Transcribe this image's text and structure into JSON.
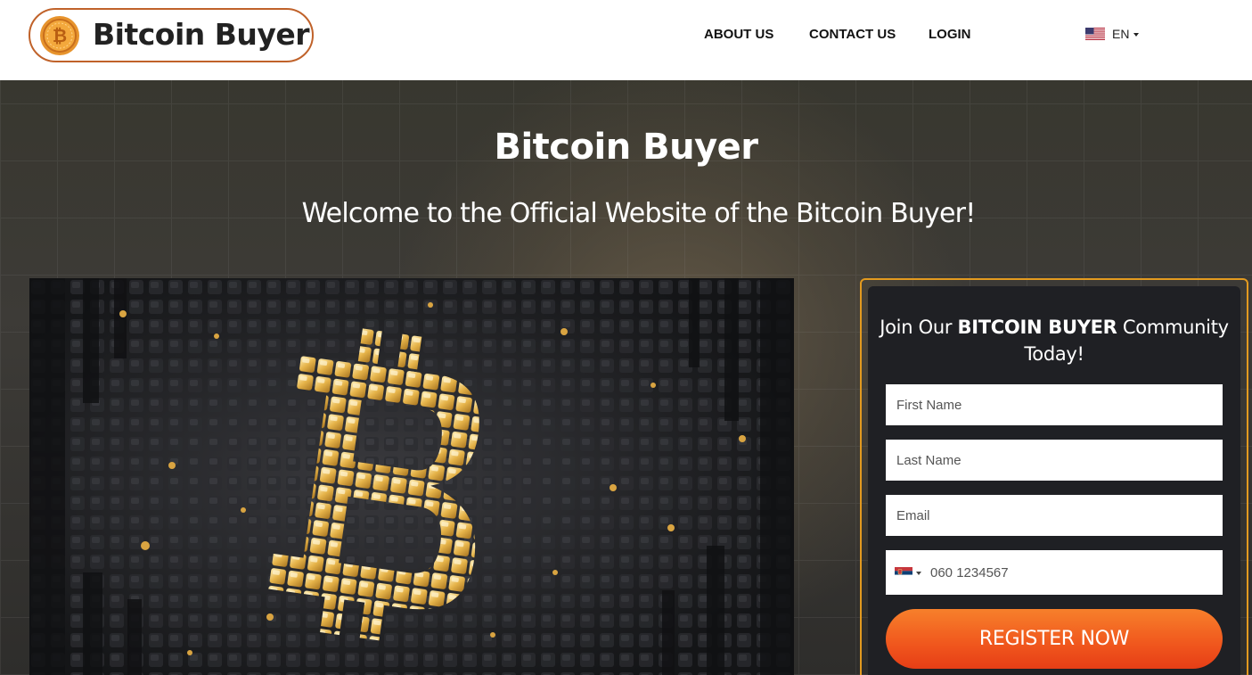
{
  "header": {
    "logo_text": "Bitcoin Buyer",
    "nav": {
      "about": "ABOUT US",
      "contact": "CONTACT US",
      "login": "LOGIN"
    },
    "language": "EN",
    "language_icon": "us-flag-icon"
  },
  "hero": {
    "title": "Bitcoin Buyer",
    "subtitle": "Welcome to the Official Website of the Bitcoin Buyer!"
  },
  "form": {
    "heading_pre": "Join Our ",
    "heading_bold": "BITCOIN BUYER",
    "heading_post": " Community Today!",
    "first_name_placeholder": "First Name",
    "last_name_placeholder": "Last Name",
    "email_placeholder": "Email",
    "phone_placeholder": "060 1234567",
    "phone_country_icon": "serbia-flag-icon",
    "submit_label": "REGISTER NOW"
  },
  "colors": {
    "brand_orange": "#c0622a",
    "form_border": "#e39a1f",
    "button_orange": "#f0561d"
  }
}
